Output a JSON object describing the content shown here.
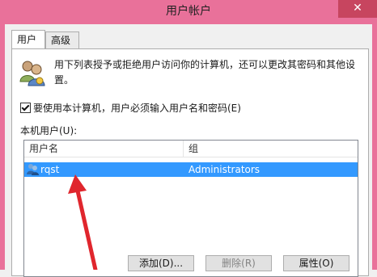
{
  "window": {
    "title": "用户帐户",
    "close_glyph": "✕"
  },
  "tabs": [
    {
      "label": "用户",
      "active": true
    },
    {
      "label": "高级",
      "active": false
    }
  ],
  "description": "用下列表授予或拒绝用户访问你的计算机，还可以更改其密码和其他设置。",
  "require_login": {
    "label": "要使用本计算机，用户必须输入用户名和密码(E)",
    "checked": true
  },
  "local_users_label": "本机用户(U):",
  "table": {
    "columns": [
      "用户名",
      "组"
    ],
    "rows": [
      {
        "name": "rqst",
        "group": "Administrators",
        "selected": true
      }
    ]
  },
  "buttons": {
    "add": "添加(D)...",
    "delete": "删除(R)",
    "properties": "属性(O)"
  },
  "colors": {
    "title_bar": "#e9719a",
    "selection": "#3399ff",
    "annotation_arrow": "#e0262d"
  },
  "icons": [
    "users-icon",
    "user-row-icon",
    "close-icon",
    "checkbox-checked-icon"
  ]
}
